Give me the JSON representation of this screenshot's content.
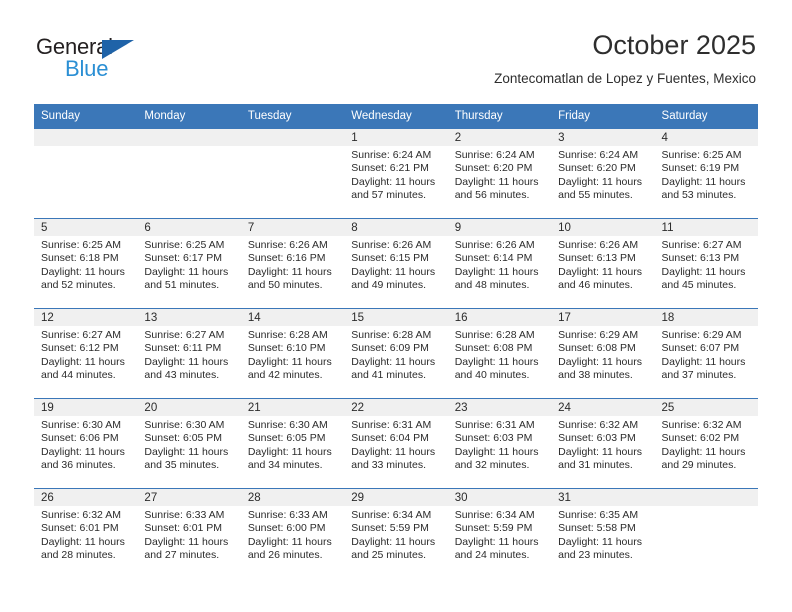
{
  "brand": {
    "name_part1": "General",
    "name_part2": "Blue",
    "triangle_icon": "triangle-icon",
    "color_dark": "#231f20",
    "color_blue": "#2b8fd4",
    "color_triangle": "#1f63a8"
  },
  "header": {
    "title": "October 2025",
    "subtitle": "Zontecomatlan de Lopez y Fuentes, Mexico"
  },
  "theme": {
    "header_bg": "#3b77b8",
    "header_text": "#ffffff",
    "daynum_bg": "#f0f0f0",
    "cell_text": "#2b2b2b"
  },
  "weekdays": [
    "Sunday",
    "Monday",
    "Tuesday",
    "Wednesday",
    "Thursday",
    "Friday",
    "Saturday"
  ],
  "weeks": [
    [
      {
        "day": "",
        "sunrise": "",
        "sunset": "",
        "daylight": "",
        "empty": true
      },
      {
        "day": "",
        "sunrise": "",
        "sunset": "",
        "daylight": "",
        "empty": true
      },
      {
        "day": "",
        "sunrise": "",
        "sunset": "",
        "daylight": "",
        "empty": true
      },
      {
        "day": "1",
        "sunrise": "Sunrise: 6:24 AM",
        "sunset": "Sunset: 6:21 PM",
        "daylight": "Daylight: 11 hours and 57 minutes."
      },
      {
        "day": "2",
        "sunrise": "Sunrise: 6:24 AM",
        "sunset": "Sunset: 6:20 PM",
        "daylight": "Daylight: 11 hours and 56 minutes."
      },
      {
        "day": "3",
        "sunrise": "Sunrise: 6:24 AM",
        "sunset": "Sunset: 6:20 PM",
        "daylight": "Daylight: 11 hours and 55 minutes."
      },
      {
        "day": "4",
        "sunrise": "Sunrise: 6:25 AM",
        "sunset": "Sunset: 6:19 PM",
        "daylight": "Daylight: 11 hours and 53 minutes."
      }
    ],
    [
      {
        "day": "5",
        "sunrise": "Sunrise: 6:25 AM",
        "sunset": "Sunset: 6:18 PM",
        "daylight": "Daylight: 11 hours and 52 minutes."
      },
      {
        "day": "6",
        "sunrise": "Sunrise: 6:25 AM",
        "sunset": "Sunset: 6:17 PM",
        "daylight": "Daylight: 11 hours and 51 minutes."
      },
      {
        "day": "7",
        "sunrise": "Sunrise: 6:26 AM",
        "sunset": "Sunset: 6:16 PM",
        "daylight": "Daylight: 11 hours and 50 minutes."
      },
      {
        "day": "8",
        "sunrise": "Sunrise: 6:26 AM",
        "sunset": "Sunset: 6:15 PM",
        "daylight": "Daylight: 11 hours and 49 minutes."
      },
      {
        "day": "9",
        "sunrise": "Sunrise: 6:26 AM",
        "sunset": "Sunset: 6:14 PM",
        "daylight": "Daylight: 11 hours and 48 minutes."
      },
      {
        "day": "10",
        "sunrise": "Sunrise: 6:26 AM",
        "sunset": "Sunset: 6:13 PM",
        "daylight": "Daylight: 11 hours and 46 minutes."
      },
      {
        "day": "11",
        "sunrise": "Sunrise: 6:27 AM",
        "sunset": "Sunset: 6:13 PM",
        "daylight": "Daylight: 11 hours and 45 minutes."
      }
    ],
    [
      {
        "day": "12",
        "sunrise": "Sunrise: 6:27 AM",
        "sunset": "Sunset: 6:12 PM",
        "daylight": "Daylight: 11 hours and 44 minutes."
      },
      {
        "day": "13",
        "sunrise": "Sunrise: 6:27 AM",
        "sunset": "Sunset: 6:11 PM",
        "daylight": "Daylight: 11 hours and 43 minutes."
      },
      {
        "day": "14",
        "sunrise": "Sunrise: 6:28 AM",
        "sunset": "Sunset: 6:10 PM",
        "daylight": "Daylight: 11 hours and 42 minutes."
      },
      {
        "day": "15",
        "sunrise": "Sunrise: 6:28 AM",
        "sunset": "Sunset: 6:09 PM",
        "daylight": "Daylight: 11 hours and 41 minutes."
      },
      {
        "day": "16",
        "sunrise": "Sunrise: 6:28 AM",
        "sunset": "Sunset: 6:08 PM",
        "daylight": "Daylight: 11 hours and 40 minutes."
      },
      {
        "day": "17",
        "sunrise": "Sunrise: 6:29 AM",
        "sunset": "Sunset: 6:08 PM",
        "daylight": "Daylight: 11 hours and 38 minutes."
      },
      {
        "day": "18",
        "sunrise": "Sunrise: 6:29 AM",
        "sunset": "Sunset: 6:07 PM",
        "daylight": "Daylight: 11 hours and 37 minutes."
      }
    ],
    [
      {
        "day": "19",
        "sunrise": "Sunrise: 6:30 AM",
        "sunset": "Sunset: 6:06 PM",
        "daylight": "Daylight: 11 hours and 36 minutes."
      },
      {
        "day": "20",
        "sunrise": "Sunrise: 6:30 AM",
        "sunset": "Sunset: 6:05 PM",
        "daylight": "Daylight: 11 hours and 35 minutes."
      },
      {
        "day": "21",
        "sunrise": "Sunrise: 6:30 AM",
        "sunset": "Sunset: 6:05 PM",
        "daylight": "Daylight: 11 hours and 34 minutes."
      },
      {
        "day": "22",
        "sunrise": "Sunrise: 6:31 AM",
        "sunset": "Sunset: 6:04 PM",
        "daylight": "Daylight: 11 hours and 33 minutes."
      },
      {
        "day": "23",
        "sunrise": "Sunrise: 6:31 AM",
        "sunset": "Sunset: 6:03 PM",
        "daylight": "Daylight: 11 hours and 32 minutes."
      },
      {
        "day": "24",
        "sunrise": "Sunrise: 6:32 AM",
        "sunset": "Sunset: 6:03 PM",
        "daylight": "Daylight: 11 hours and 31 minutes."
      },
      {
        "day": "25",
        "sunrise": "Sunrise: 6:32 AM",
        "sunset": "Sunset: 6:02 PM",
        "daylight": "Daylight: 11 hours and 29 minutes."
      }
    ],
    [
      {
        "day": "26",
        "sunrise": "Sunrise: 6:32 AM",
        "sunset": "Sunset: 6:01 PM",
        "daylight": "Daylight: 11 hours and 28 minutes."
      },
      {
        "day": "27",
        "sunrise": "Sunrise: 6:33 AM",
        "sunset": "Sunset: 6:01 PM",
        "daylight": "Daylight: 11 hours and 27 minutes."
      },
      {
        "day": "28",
        "sunrise": "Sunrise: 6:33 AM",
        "sunset": "Sunset: 6:00 PM",
        "daylight": "Daylight: 11 hours and 26 minutes."
      },
      {
        "day": "29",
        "sunrise": "Sunrise: 6:34 AM",
        "sunset": "Sunset: 5:59 PM",
        "daylight": "Daylight: 11 hours and 25 minutes."
      },
      {
        "day": "30",
        "sunrise": "Sunrise: 6:34 AM",
        "sunset": "Sunset: 5:59 PM",
        "daylight": "Daylight: 11 hours and 24 minutes."
      },
      {
        "day": "31",
        "sunrise": "Sunrise: 6:35 AM",
        "sunset": "Sunset: 5:58 PM",
        "daylight": "Daylight: 11 hours and 23 minutes."
      },
      {
        "day": "",
        "sunrise": "",
        "sunset": "",
        "daylight": "",
        "empty": true
      }
    ]
  ]
}
